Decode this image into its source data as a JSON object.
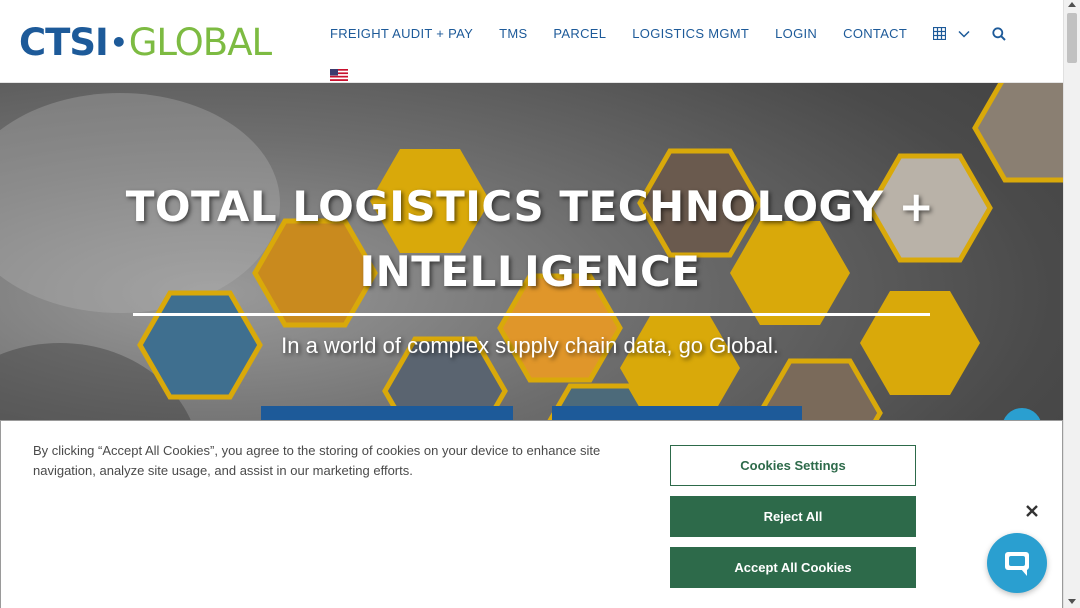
{
  "logo": {
    "part1": "CTSI",
    "separator": "•",
    "part2": "GLOBAL"
  },
  "nav": {
    "items": [
      {
        "label": "FREIGHT AUDIT + PAY"
      },
      {
        "label": "TMS"
      },
      {
        "label": "PARCEL"
      },
      {
        "label": "LOGISTICS MGMT"
      },
      {
        "label": "LOGIN"
      },
      {
        "label": "CONTACT"
      }
    ],
    "icons": [
      "grid-icon",
      "chevron-down-icon",
      "search-icon"
    ],
    "flag": "us-flag-icon"
  },
  "hero": {
    "title_line1": "TOTAL LOGISTICS TECHNOLOGY +",
    "title_line2": "INTELLIGENCE",
    "subtitle": "In a world of complex supply chain data, go Global."
  },
  "cookie": {
    "text": "By clicking “Accept All Cookies”, you agree to the storing of cookies on your device to enhance site navigation, analyze site usage, and assist in our marketing efforts.",
    "settings_label": "Cookies Settings",
    "reject_label": "Reject All",
    "accept_label": "Accept All Cookies",
    "close_icon": "close-icon"
  },
  "chat": {
    "icon": "chat-bubble-icon"
  },
  "colors": {
    "brand_blue": "#1d5a99",
    "brand_green": "#7dbb42",
    "hex_gold": "#d9a90a",
    "button_green": "#2d6a4a",
    "chat_blue": "#2a9fd0"
  }
}
